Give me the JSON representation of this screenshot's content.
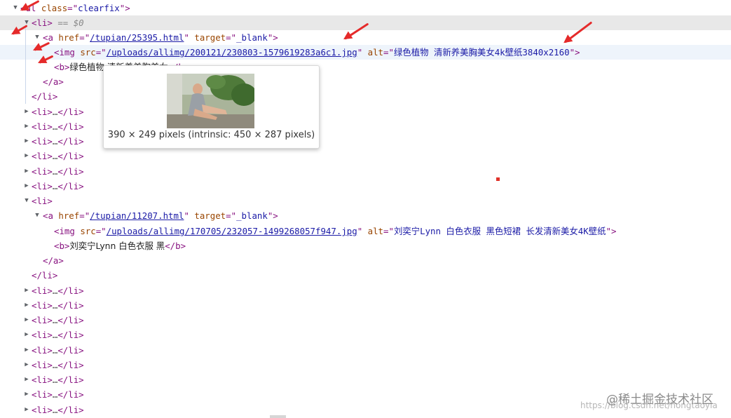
{
  "colors": {
    "tag": "#881280",
    "attribute": "#994500",
    "value": "#1a1aa6",
    "selected_row": "#e8e8e8",
    "annotation_arrow": "#e52a2a"
  },
  "icons": {
    "expanded": "triangle-down-icon",
    "collapsed": "triangle-right-icon"
  },
  "tree": {
    "ul_open": {
      "tag": "<ul",
      "attr": "class",
      "eq": "=\"",
      "val": "clearfix",
      "close": "\">"
    },
    "li1": {
      "tag": "<li>",
      "marker": "== $0"
    },
    "a1": {
      "tag": "<a",
      "attr1": "href",
      "eq": "=\"",
      "href": "/tupian/25395.html",
      "q": "\"",
      "attr2": "target",
      "target": "_blank",
      "close": "\">"
    },
    "img1": {
      "tag": "<img",
      "attr1": "src",
      "eq": "=\"",
      "src": "/uploads/allimg/200121/230803-1579619283a6c1.jpg",
      "q": "\"",
      "attr2": "alt",
      "alt": "绿色植物 清新养美胸美女4k壁纸3840x2160",
      "close": "\">"
    },
    "b1": {
      "tag": "<b>",
      "text": "绿色植物 清新养美胸美女",
      "close": "</b>"
    },
    "a_close": "</a>",
    "li_close": "</li>",
    "collapsed_li": {
      "open": "<li>",
      "dots": "…",
      "close": "</li>"
    },
    "a2": {
      "tag": "<a",
      "attr1": "href",
      "eq": "=\"",
      "href": "/tupian/11207.html",
      "q": "\"",
      "attr2": "target",
      "target": "_blank",
      "close": "\">"
    },
    "img2": {
      "tag": "<img",
      "attr1": "src",
      "eq": "=\"",
      "src": "/uploads/allimg/170705/232057-1499268057f947.jpg",
      "q": "\"",
      "attr2": "alt",
      "alt": "刘奕宁Lynn 白色衣服 黑色短裙 长发清新美女4K壁纸",
      "close": "\">"
    },
    "b2": {
      "tag": "<b>",
      "text": "刘奕宁Lynn 白色衣服 黑",
      "close": "</b>"
    }
  },
  "tooltip": {
    "caption": "390 × 249 pixels (intrinsic: 450 × 287 pixels)"
  },
  "watermark": {
    "main": "@稀土掘金技术社区",
    "sub": "https://blog.csdn.net/hongtaoyla"
  }
}
